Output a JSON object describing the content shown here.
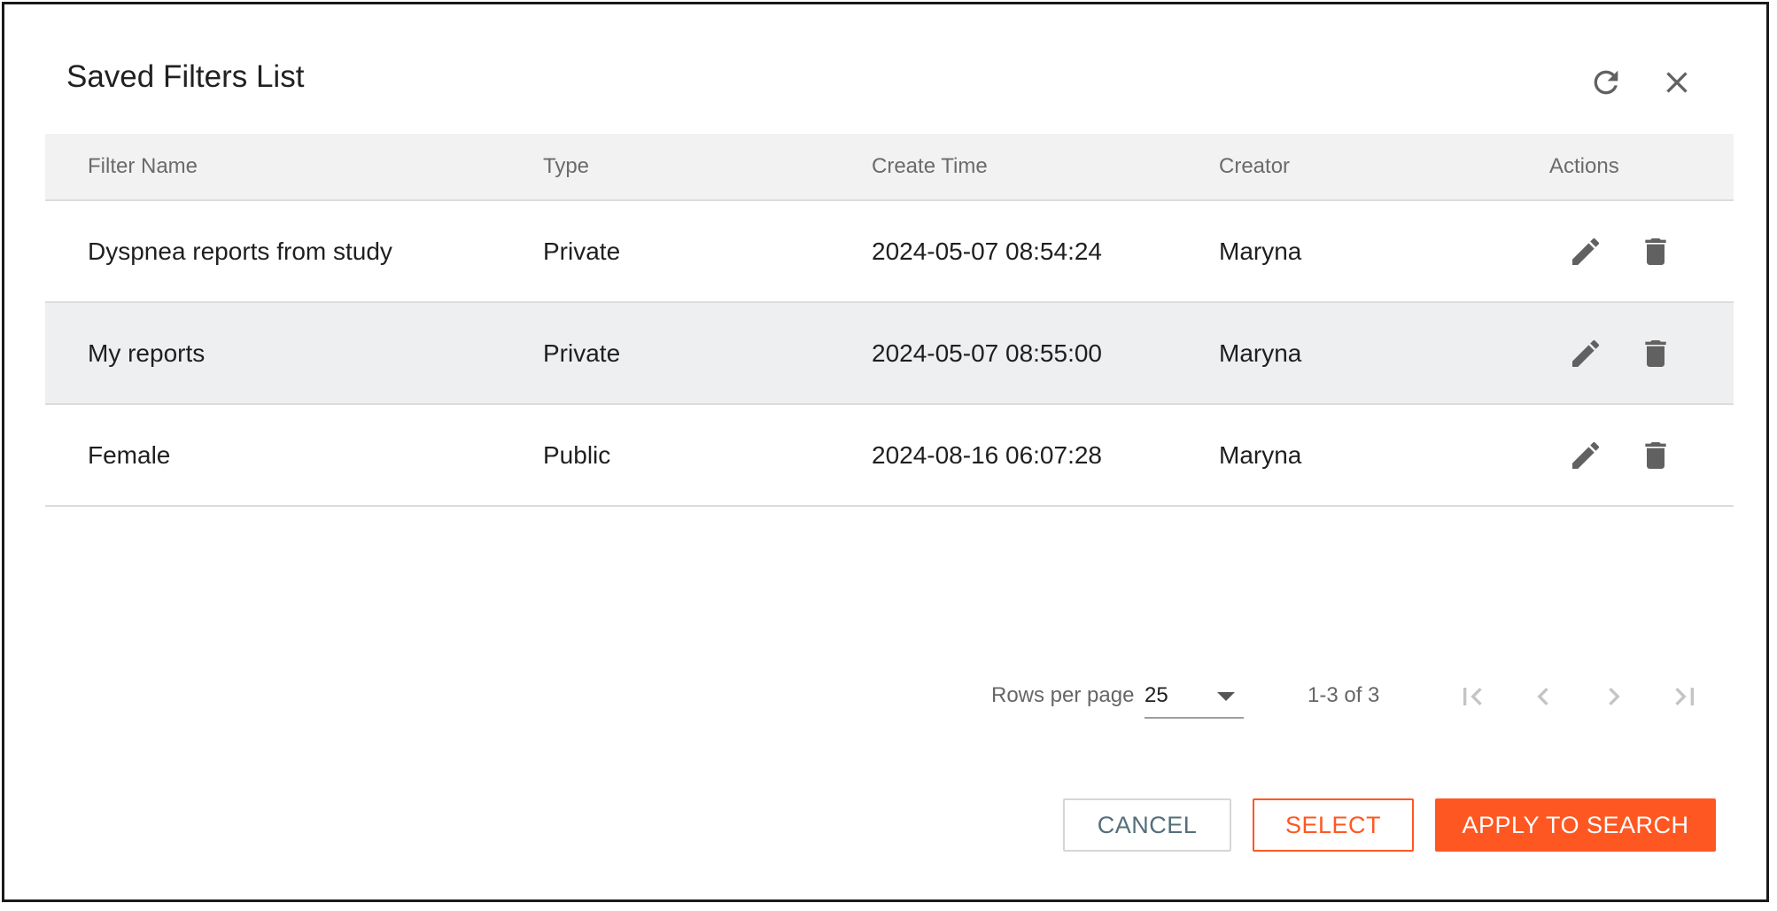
{
  "dialog": {
    "title": "Saved Filters List",
    "refresh_icon": "refresh-icon",
    "close_icon": "close-icon"
  },
  "table": {
    "headers": {
      "filter_name": "Filter Name",
      "type": "Type",
      "create_time": "Create Time",
      "creator": "Creator",
      "actions": "Actions"
    },
    "rows": [
      {
        "filter_name": "Dyspnea reports from study",
        "type": "Private",
        "create_time": "2024-05-07 08:54:24",
        "creator": "Maryna"
      },
      {
        "filter_name": "My reports",
        "type": "Private",
        "create_time": "2024-05-07 08:55:00",
        "creator": "Maryna"
      },
      {
        "filter_name": "Female",
        "type": "Public",
        "create_time": "2024-08-16 06:07:28",
        "creator": "Maryna"
      }
    ],
    "row_action_icons": [
      "edit-icon",
      "delete-icon"
    ]
  },
  "pagination": {
    "rows_per_page_label": "Rows per page",
    "rows_per_page_value": "25",
    "range_text": "1-3 of 3",
    "icons": [
      "first-page-icon",
      "previous-page-icon",
      "next-page-icon",
      "last-page-icon"
    ]
  },
  "buttons": {
    "cancel": "CANCEL",
    "select": "SELECT",
    "apply": "APPLY TO SEARCH"
  },
  "colors": {
    "accent": "#ff5722",
    "header_bg": "#f2f2f2",
    "selected_row_bg": "#eeeff0",
    "icon": "#616161"
  }
}
